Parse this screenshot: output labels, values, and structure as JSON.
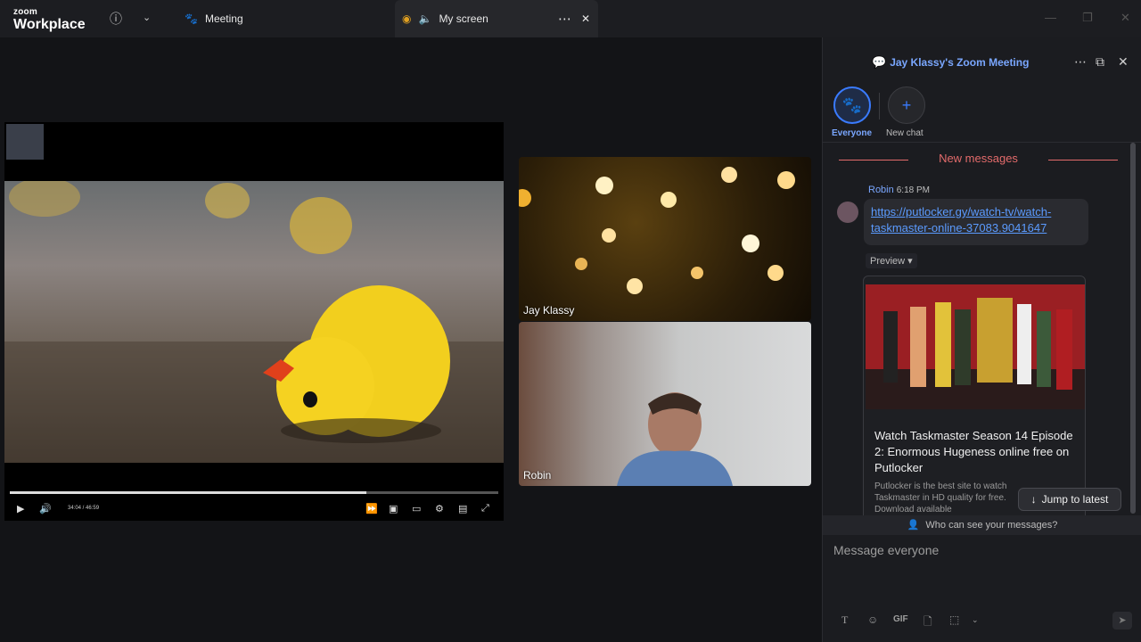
{
  "app": {
    "brand_top": "zoom",
    "brand_bottom": "Workplace"
  },
  "titlebar": {
    "info_icon": "info-icon",
    "dropdown_icon": "chevron-down-icon",
    "tabs": [
      {
        "label": "Meeting",
        "icon": "paw-icon",
        "active": false
      },
      {
        "label": "My screen",
        "icon": "speaker-icon",
        "active": true
      }
    ],
    "more_icon": "more-icon",
    "close_tab_icon": "close-icon"
  },
  "share": {
    "progress": 0.73,
    "time": "34:04 / 46:59"
  },
  "participants": [
    {
      "name": "Jay Klassy"
    },
    {
      "name": "Robin"
    }
  ],
  "chat": {
    "title": "Jay Klassy's Zoom Meeting",
    "tabs": [
      {
        "label": "Everyone",
        "active": true
      },
      {
        "label": "New chat",
        "active": false
      }
    ],
    "new_messages_label": "New messages",
    "message": {
      "sender": "Robin",
      "time": "6:18 PM",
      "link_line1": "https://putlocker.gy/watch-tv/watch-",
      "link_line2": "taskmaster-online-37083.9041647"
    },
    "preview_label": "Preview ▾",
    "card": {
      "title": "Watch Taskmaster Season 14 Episode 2: Enormous Hugeness online free on Putlocker",
      "description": "Putlocker is the best site to watch Taskmaster in HD quality for free. Download available"
    },
    "jump_label": "Jump to latest",
    "who_label": "Who can see your messages?",
    "input_placeholder": "Message everyone",
    "toolbar": {
      "gif": "GIF"
    },
    "colors": {
      "accent": "#3a7bff",
      "new_messages": "#e36b6b"
    }
  }
}
